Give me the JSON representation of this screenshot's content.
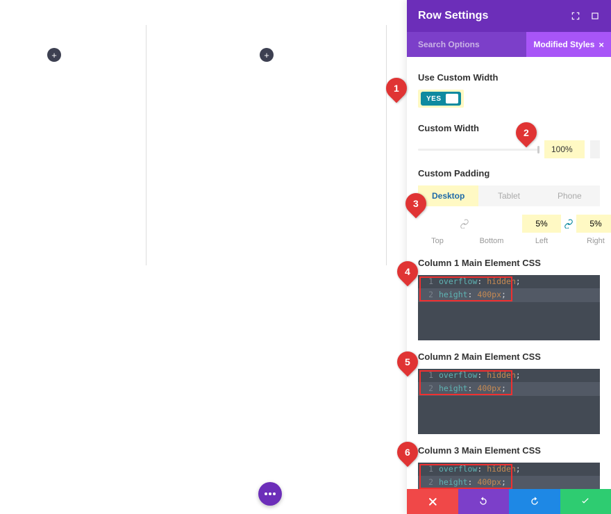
{
  "panel": {
    "title": "Row Settings",
    "search_placeholder": "Search Options",
    "active_filter": "Modified Styles"
  },
  "fields": {
    "use_custom_width": {
      "label": "Use Custom Width",
      "toggle": "YES"
    },
    "custom_width": {
      "label": "Custom Width",
      "value": "100%"
    },
    "custom_padding": {
      "label": "Custom Padding",
      "devices": {
        "desktop": "Desktop",
        "tablet": "Tablet",
        "phone": "Phone"
      },
      "top": {
        "value": "",
        "label": "Top"
      },
      "bottom": {
        "value": "",
        "label": "Bottom"
      },
      "left": {
        "value": "5%",
        "label": "Left"
      },
      "right": {
        "value": "5%",
        "label": "Right"
      }
    },
    "css": {
      "col1": {
        "label": "Column 1 Main Element CSS",
        "l1_prop": "overflow",
        "l1_val": "hidden",
        "l2_prop": "height",
        "l2_val": "400px"
      },
      "col2": {
        "label": "Column 2 Main Element CSS",
        "l1_prop": "overflow",
        "l1_val": "hidden",
        "l2_prop": "height",
        "l2_val": "400px"
      },
      "col3": {
        "label": "Column 3 Main Element CSS",
        "l1_prop": "overflow",
        "l1_val": "hidden",
        "l2_prop": "height",
        "l2_val": "400px"
      }
    }
  },
  "callouts": {
    "c1": "1",
    "c2": "2",
    "c3": "3",
    "c4": "4",
    "c5": "5",
    "c6": "6"
  }
}
